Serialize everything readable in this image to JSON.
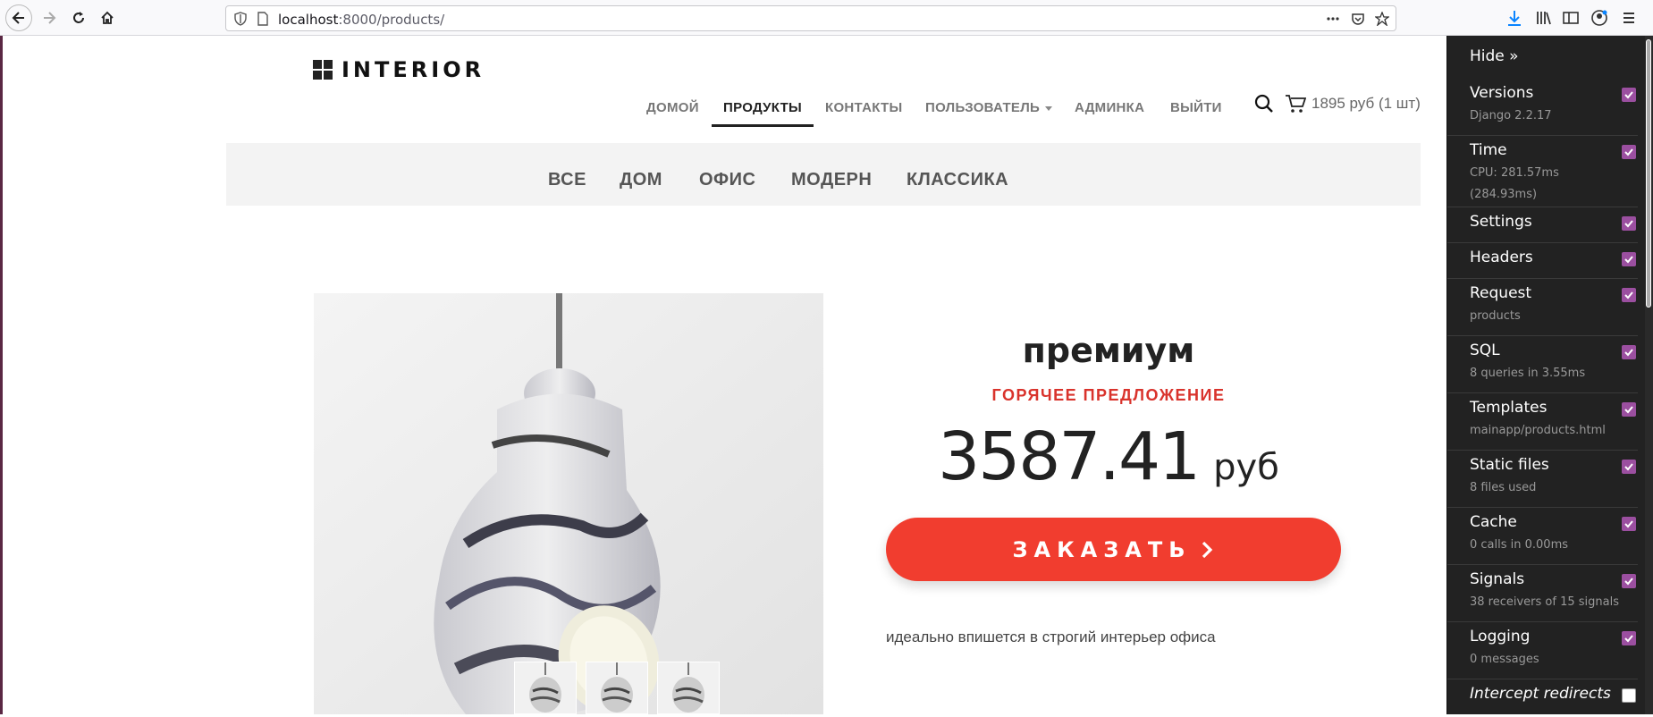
{
  "browser": {
    "url_host": "localhost",
    "url_path": ":8000/products/"
  },
  "site": {
    "logo": "INTERIOR",
    "nav": [
      {
        "label": "ДОМОЙ",
        "active": false
      },
      {
        "label": "ПРОДУКТЫ",
        "active": true
      },
      {
        "label": "КОНТАКТЫ",
        "active": false
      },
      {
        "label": "ПОЛЬЗОВАТЕЛЬ",
        "active": false
      },
      {
        "label": "АДМИНКА",
        "active": false
      },
      {
        "label": "ВЫЙТИ",
        "active": false
      }
    ],
    "cart": "1895 руб (1 шт)",
    "categories": [
      "ВСЕ",
      "ДОМ",
      "ОФИС",
      "МОДЕРН",
      "КЛАССИКА"
    ]
  },
  "product": {
    "title": "премиум",
    "hot": "ГОРЯЧЕЕ ПРЕДЛОЖЕНИЕ",
    "price": "3587.41",
    "currency": "руб",
    "order_button": "ЗАКАЗАТЬ",
    "description": "идеально впишется в строгий интерьер офиса"
  },
  "debug_toolbar": {
    "hide": "Hide »",
    "panels": [
      {
        "title": "Versions",
        "sub": "Django 2.2.17",
        "checked": true
      },
      {
        "title": "Time",
        "sub": "CPU: 281.57ms",
        "sub2": "(284.93ms)",
        "checked": true
      },
      {
        "title": "Settings",
        "sub": "",
        "checked": true
      },
      {
        "title": "Headers",
        "sub": "",
        "checked": true
      },
      {
        "title": "Request",
        "sub": "products",
        "checked": true
      },
      {
        "title": "SQL",
        "sub": "8 queries in 3.55ms",
        "checked": true
      },
      {
        "title": "Templates",
        "sub": "mainapp/products.html",
        "checked": true
      },
      {
        "title": "Static files",
        "sub": "8 files used",
        "checked": true
      },
      {
        "title": "Cache",
        "sub": "0 calls in 0.00ms",
        "checked": true
      },
      {
        "title": "Signals",
        "sub": "38 receivers of 15 signals",
        "checked": true
      },
      {
        "title": "Logging",
        "sub": "0 messages",
        "checked": true
      },
      {
        "title": "Intercept redirects",
        "sub": "",
        "checked": false
      }
    ]
  },
  "colors": {
    "accent_red": "#f13d2f",
    "hot_red": "#d9332c",
    "toolbar_bg": "#222222",
    "checkbox": "#9b4fa0"
  }
}
